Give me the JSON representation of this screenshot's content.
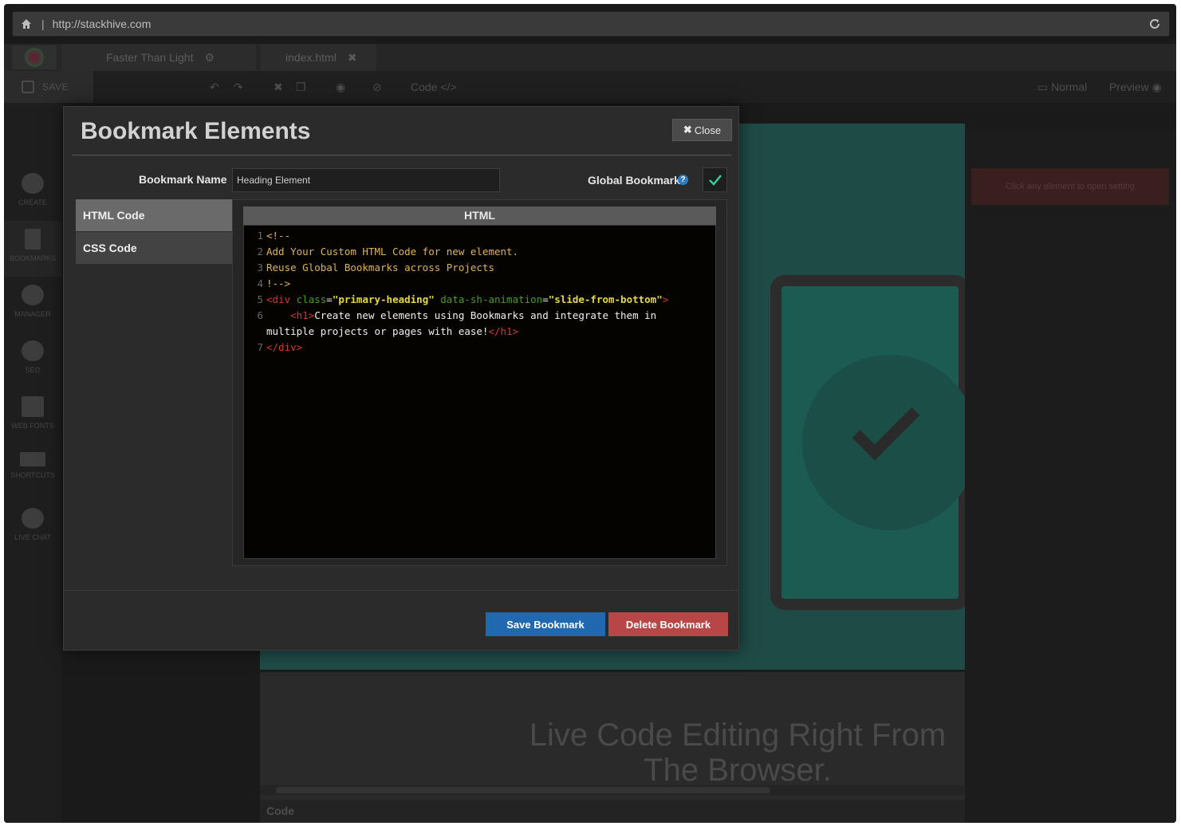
{
  "browser": {
    "url": "http://stackhive.com"
  },
  "tabs": [
    {
      "label": "Faster Than Light"
    },
    {
      "label": "index.html"
    }
  ],
  "toolbar": {
    "save_label": "SAVE",
    "code_label": "Code",
    "normal_label": "Normal",
    "preview_label": "Preview"
  },
  "sidebar": {
    "items": [
      {
        "label": "CREATE",
        "icon": "plus-circle-icon"
      },
      {
        "label": "BOOKMARKS",
        "icon": "bookmark-icon"
      },
      {
        "label": "MANAGER",
        "icon": "gears-icon"
      },
      {
        "label": "SEO",
        "icon": "search-icon"
      },
      {
        "label": "WEB FONTS",
        "icon": "font-icon"
      },
      {
        "label": "SHORTCUTS",
        "icon": "keyboard-icon"
      },
      {
        "label": "LIVE CHAT",
        "icon": "chat-icon"
      }
    ]
  },
  "right_panel": {
    "hint": "Click any element to open setting"
  },
  "canvas": {
    "headline": "Live Code Editing Right From The Browser.",
    "code_bar_label": "Code"
  },
  "modal": {
    "title": "Bookmark Elements",
    "close_label": "Close",
    "name_label": "Bookmark Name",
    "name_value": "Heading Element",
    "global_label": "Global Bookmark",
    "global_checked": true,
    "side_tabs": [
      {
        "label": "HTML Code",
        "active": true
      },
      {
        "label": "CSS Code",
        "active": false
      }
    ],
    "editor_header": "HTML",
    "code_lines": [
      {
        "n": "1",
        "parts": [
          {
            "t": "<!--",
            "c": "cmt"
          }
        ]
      },
      {
        "n": "2",
        "parts": [
          {
            "t": "Add Your Custom HTML Code for new element.",
            "c": "cmt"
          }
        ]
      },
      {
        "n": "3",
        "parts": [
          {
            "t": "Reuse Global Bookmarks across Projects",
            "c": "cmt"
          }
        ]
      },
      {
        "n": "4",
        "parts": [
          {
            "t": "!-->",
            "c": "cmt"
          }
        ]
      },
      {
        "n": "5",
        "parts": [
          {
            "t": "<div ",
            "c": "tag"
          },
          {
            "t": "class",
            "c": "attr"
          },
          {
            "t": "=",
            "c": "txt"
          },
          {
            "t": "\"primary-heading\"",
            "c": "str"
          },
          {
            "t": " data-sh-animation",
            "c": "attr"
          },
          {
            "t": "=",
            "c": "txt"
          },
          {
            "t": "\"slide-from-bottom\"",
            "c": "str"
          },
          {
            "t": ">",
            "c": "tag"
          }
        ]
      },
      {
        "n": "6",
        "parts": [
          {
            "t": "    <h1>",
            "c": "tag"
          },
          {
            "t": "Create new elements using Bookmarks and integrate them in multiple projects or pages with ease!",
            "c": "txt"
          },
          {
            "t": "</h1>",
            "c": "tag"
          }
        ]
      },
      {
        "n": "7",
        "parts": [
          {
            "t": "</div>",
            "c": "tag"
          }
        ]
      }
    ],
    "save_label": "Save Bookmark",
    "delete_label": "Delete Bookmark",
    "colors": {
      "save": "#2068b0",
      "delete": "#b94646",
      "check": "#2fd19a"
    }
  }
}
